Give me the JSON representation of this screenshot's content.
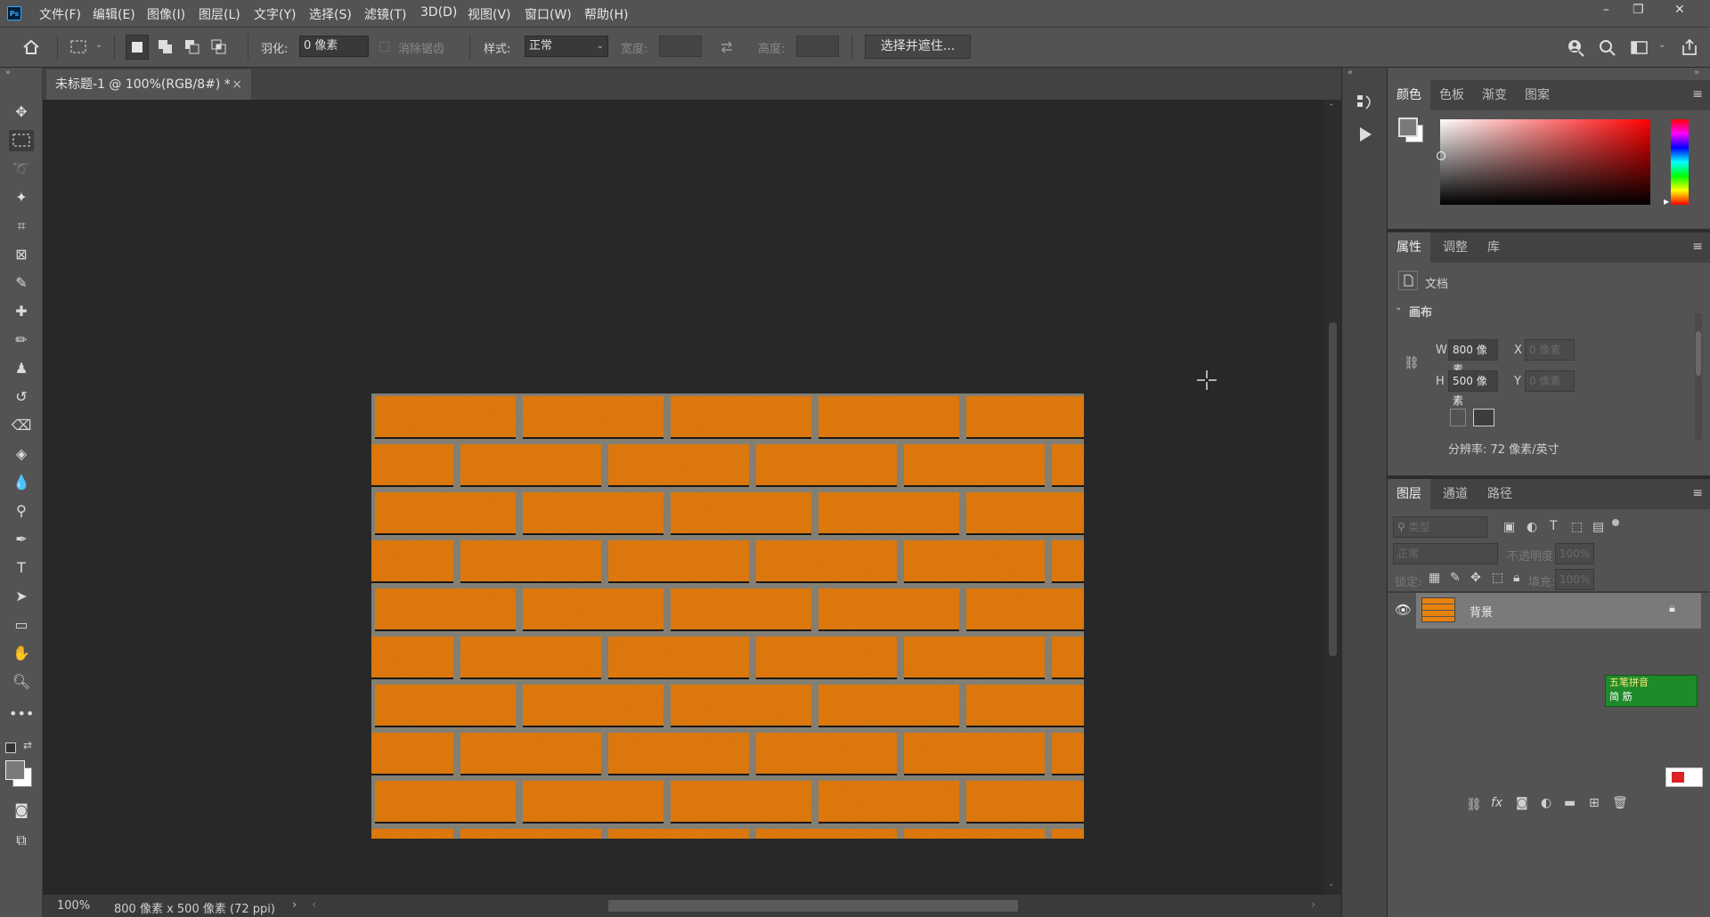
{
  "app": {
    "logo": "Ps"
  },
  "menu": [
    "文件(F)",
    "编辑(E)",
    "图像(I)",
    "图层(L)",
    "文字(Y)",
    "选择(S)",
    "滤镜(T)",
    "3D(D)",
    "视图(V)",
    "窗口(W)",
    "帮助(H)"
  ],
  "window_controls": {
    "minimize": "–",
    "restore": "❐",
    "close": "✕"
  },
  "options": {
    "feather_label": "羽化:",
    "feather_value": "0 像素",
    "antialias_label": "消除锯齿",
    "style_label": "样式:",
    "style_value": "正常",
    "width_label": "宽度:",
    "height_label": "高度:",
    "select_mask_button": "选择并遮住..."
  },
  "document_tab": {
    "title": "未标题-1 @ 100%(RGB/8#) *",
    "close": "×"
  },
  "status": {
    "zoom": "100%",
    "doc_info": "800 像素 x 500 像素 (72 ppi)",
    "arrow": "›"
  },
  "color_panel": {
    "tabs": [
      "颜色",
      "色板",
      "渐变",
      "图案"
    ],
    "active": "颜色"
  },
  "properties_panel": {
    "tabs": [
      "属性",
      "调整",
      "库"
    ],
    "active": "属性",
    "doc_label": "文档",
    "section": "画布",
    "w_label": "W",
    "w_value": "800 像素",
    "h_label": "H",
    "h_value": "500 像素",
    "x_label": "X",
    "x_value": "0 像素",
    "y_label": "Y",
    "y_value": "0 像素",
    "resolution": "分辨率: 72 像素/英寸"
  },
  "layers_panel": {
    "tabs": [
      "图层",
      "通道",
      "路径"
    ],
    "active": "图层",
    "filter_placeholder": "类型",
    "blend_mode": "正常",
    "opacity_label": "不透明度:",
    "opacity_value": "100%",
    "lock_label": "锁定:",
    "fill_label": "填充:",
    "fill_value": "100%",
    "layers": [
      {
        "name": "背景",
        "visible": true,
        "locked": true
      }
    ]
  },
  "ime": {
    "line1": "五笔拼音",
    "line2": "简 筋"
  },
  "colors": {
    "ui_bg": "#535353",
    "canvas_bg": "#282828",
    "brick": "#e8820e",
    "mortar": "#8a8a8a"
  }
}
